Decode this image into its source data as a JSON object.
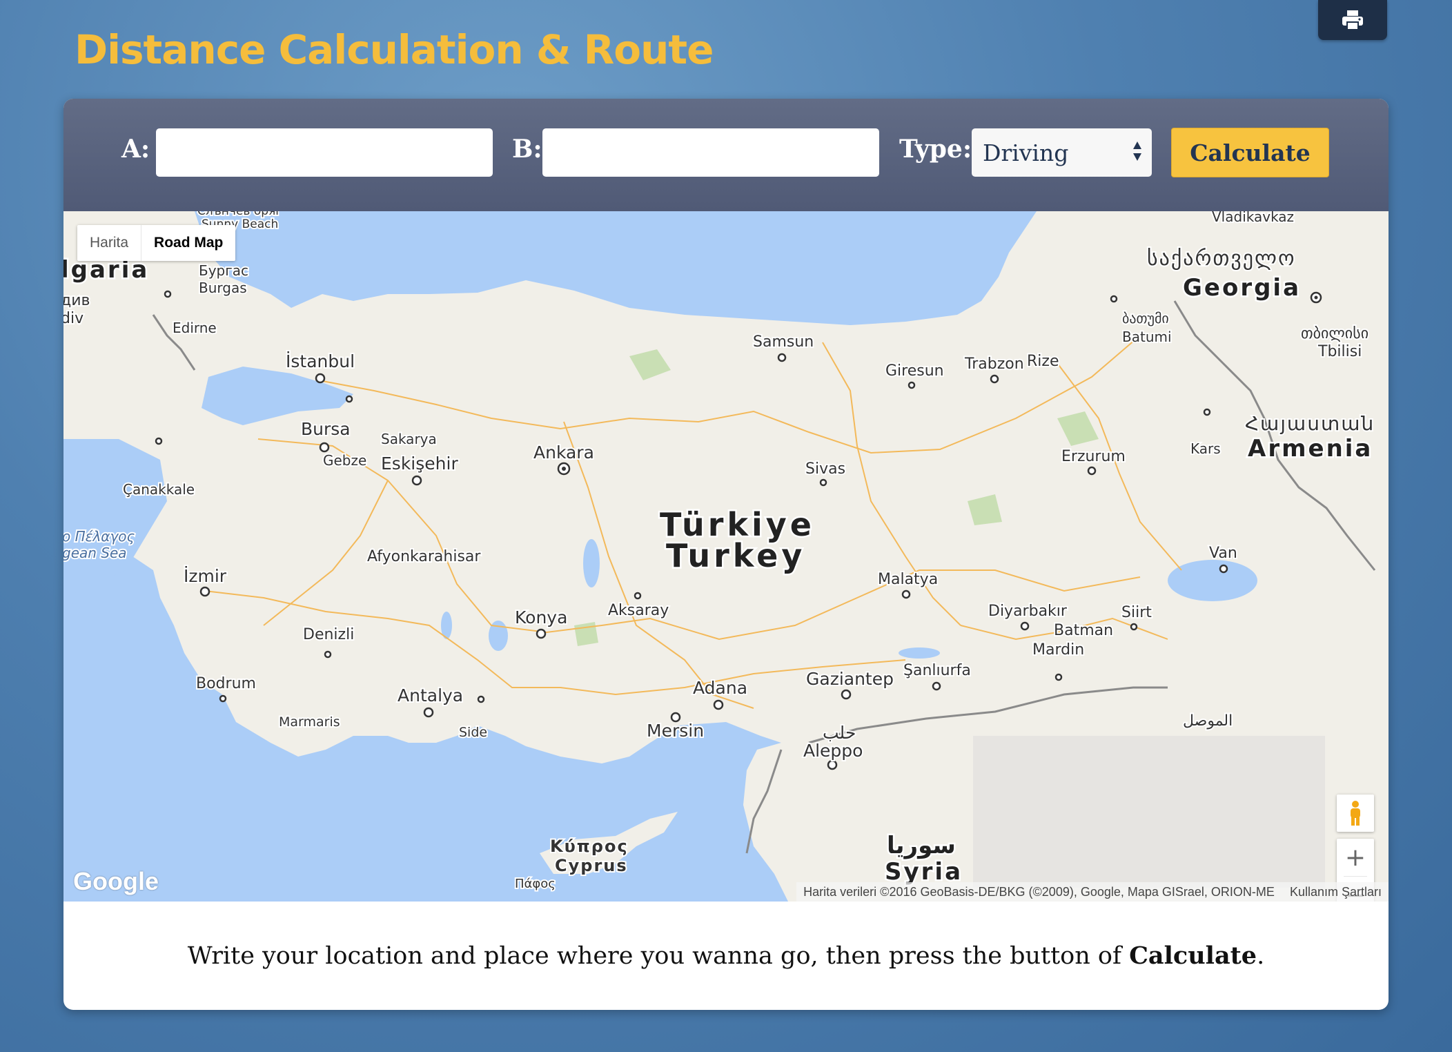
{
  "header": {
    "title": "Distance Calculation & Route",
    "print_icon": "print-icon"
  },
  "form": {
    "a_label": "A:",
    "a_value": "",
    "b_label": "B:",
    "b_value": "",
    "type_label": "Type:",
    "type_selected": "Driving",
    "calculate_label": "Calculate"
  },
  "map": {
    "map_types": [
      "Harita",
      "Road Map"
    ],
    "active_map_type": "Road Map",
    "attribution": "Harita verileri ©2016 GeoBasis-DE/BKG (©2009), Google, Mapa GISrael, ORION-ME",
    "terms": "Kullanım Şartları",
    "logo": "Google",
    "zoom_in": "+",
    "zoom_out": "−",
    "pegman_icon": "pegman-icon",
    "countries": {
      "turkey_native": "Türkiye",
      "turkey": "Turkey",
      "bulgaria": "lgaria",
      "georgia_native": "საქართველო",
      "georgia": "Georgia",
      "armenia_native": "Հայաստան",
      "armenia": "Armenia",
      "syria_native": "سوريا",
      "syria": "Syria",
      "cyprus_native": "Κύπρος",
      "cyprus": "Cyprus"
    },
    "cities": {
      "istanbul": "İstanbul",
      "ankara": "Ankara",
      "izmir": "İzmir",
      "bursa": "Bursa",
      "antalya": "Antalya",
      "konya": "Konya",
      "adana": "Adana",
      "mersin": "Mersin",
      "samsun": "Samsun",
      "trabzon": "Trabzon",
      "rize": "Rize",
      "giresun": "Giresun",
      "sivas": "Sivas",
      "erzurum": "Erzurum",
      "malatya": "Malatya",
      "van": "Van",
      "diyarbakir": "Diyarbakır",
      "siirt": "Siirt",
      "batman": "Batman",
      "mardin": "Mardin",
      "sanliurfa": "Şanlıurfa",
      "gaziantep": "Gaziantep",
      "aleppo_native": "حلب",
      "aleppo": "Aleppo",
      "eskisehir": "Eskişehir",
      "afyonkarahisar": "Afyonkarahisar",
      "aksaray": "Aksaray",
      "denizli": "Denizli",
      "bodrum": "Bodrum",
      "marmaris": "Marmaris",
      "side": "Side",
      "canakkale": "Çanakkale",
      "edirne": "Edirne",
      "sakarya": "Sakarya",
      "gebze": "Gebze",
      "kars": "Kars",
      "tbilisi_native": "თბილისი",
      "tbilisi": "Tbilisi",
      "batumi_native": "ბათუმი",
      "batumi": "Batumi",
      "burgas_native": "Бургас",
      "burgas": "Burgas",
      "vladikavkaz": "Vladikavkaz",
      "sunny_beach_native": "Слънчев бряг",
      "sunny_beach": "Sunny Beach",
      "mosul": "الموصل",
      "paphos": "Πάφος",
      "aegean_native": "ο Πέλαγος",
      "aegean": "gean Sea",
      "plovdiv_native": "див",
      "plovdiv": "div"
    }
  },
  "instruction": {
    "text": "Write your location and place where you wanna go, then press the button of ",
    "bold": "Calculate",
    "end": "."
  },
  "colors": {
    "background": "#4f80b0",
    "title": "#f5bd3c",
    "toolbar": "#59627e",
    "button": "#f7c33f",
    "button_text": "#233552",
    "water": "#abcdf7",
    "land": "#f1efe8"
  }
}
